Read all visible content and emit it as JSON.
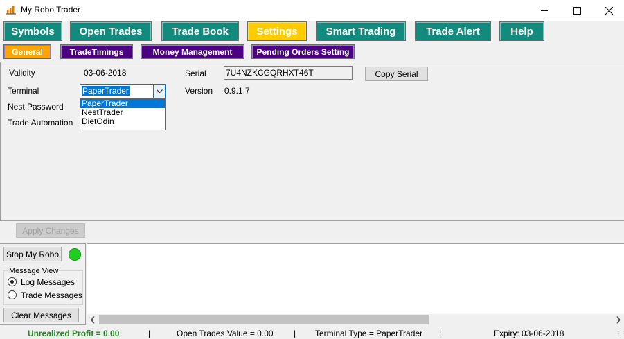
{
  "window": {
    "title": "My Robo Trader",
    "accent": "#138a7e"
  },
  "main_tabs": [
    {
      "label": "Symbols",
      "active": false
    },
    {
      "label": "Open Trades",
      "active": false
    },
    {
      "label": "Trade Book",
      "active": false
    },
    {
      "label": "Settings",
      "active": true
    },
    {
      "label": "Smart Trading",
      "active": false
    },
    {
      "label": "Trade Alert",
      "active": false
    },
    {
      "label": "Help",
      "active": false
    }
  ],
  "sub_tabs": [
    {
      "label": "General",
      "active": true
    },
    {
      "label": "TradeTimings",
      "active": false
    },
    {
      "label": "Money Management",
      "active": false
    },
    {
      "label": "Pending Orders Setting",
      "active": false
    }
  ],
  "general": {
    "validity_label": "Validity",
    "validity_value": "03-06-2018",
    "terminal_label": "Terminal",
    "terminal_value": "PaperTrader",
    "terminal_options": [
      "PaperTrader",
      "NestTrader",
      "DietOdin"
    ],
    "nest_password_label": "Nest Password",
    "trade_automation_label": "Trade Automation",
    "serial_label": "Serial",
    "serial_value": "7U4NZKCGQRHXT46T",
    "copy_serial_label": "Copy Serial",
    "version_label": "Version",
    "version_value": "0.9.1.7"
  },
  "apply_changes_label": "Apply Changes",
  "robo": {
    "stop_label": "Stop My Robo",
    "status_color": "#22cc22"
  },
  "message_view": {
    "title": "Message View",
    "log_label": "Log Messages",
    "trade_label": "Trade Messages",
    "selected": "log",
    "clear_label": "Clear Messages"
  },
  "status": {
    "unrealized_profit": "Unrealized Profit = 0.00",
    "open_trades_value": "Open Trades Value = 0.00",
    "terminal_type": "Terminal Type = PaperTrader",
    "expiry": "Expiry: 03-06-2018",
    "separator": "|"
  }
}
